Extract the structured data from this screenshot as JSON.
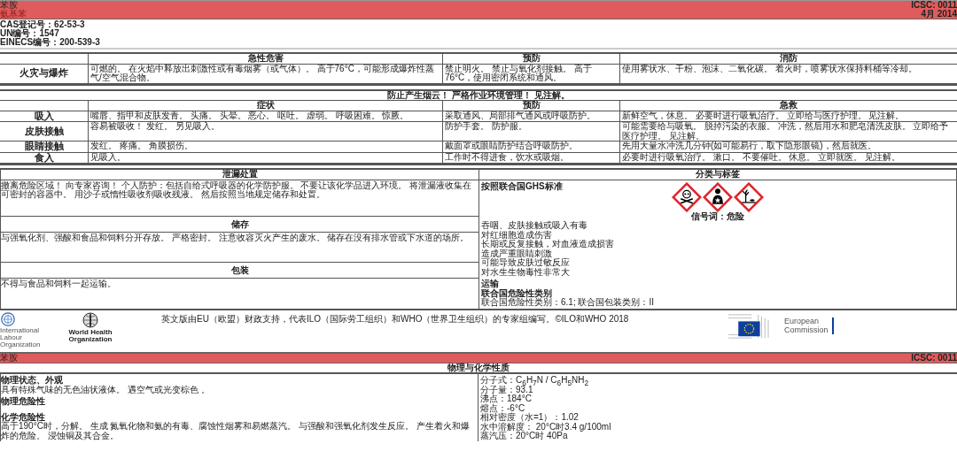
{
  "header": {
    "name": "苯胺",
    "synonym": "氨基苯",
    "icsc": "ICSC: 0011",
    "date": "4月 2014"
  },
  "identifiers": [
    "CAS登记号：62-53-3",
    "UN编号：1547",
    "EINECS编号：200-539-3"
  ],
  "fire_table": {
    "columns": [
      "急性危害",
      "预防",
      "消防"
    ],
    "rows": [
      {
        "label": "火灾与爆炸",
        "cells": [
          "可燃的。 在火焰中释放出刺激性或有毒烟雾（或气体）。 高于76°C，可能形成爆炸性蒸气/空气混合物。",
          "禁止明火。 禁止与氧化剂接触。 高于76°C，使用密闭系统和通风。",
          "使用雾状水、干粉、泡沫、二氧化碳。 着火时，喷雾状水保持料桶等冷却。"
        ]
      }
    ]
  },
  "banner": "防止产生烟云！ 严格作业环境管理！ 见注解。",
  "exposure_table": {
    "columns": [
      "症状",
      "预防",
      "急救"
    ],
    "rows": [
      {
        "label": "吸入",
        "cells": [
          "嘴唇、指甲和皮肤发青。 头痛。 头晕。 恶心。 呕吐。 虚弱。 呼吸困难。 惊厥。",
          "采取通风、局部排气通风或呼吸防护。",
          "新鲜空气，休息。 必要时进行吸氧治疗。 立即给与医疗护理。 见注解。"
        ]
      },
      {
        "label": "皮肤接触",
        "cells": [
          "容易被吸收！ 发红。 另见吸入。",
          "防护手套。 防护服。",
          "可能需要给与吸氧。 脱掉污染的衣服。 冲洗，然后用水和肥皂清洗皮肤。 立即给予医疗护理。 见注解。"
        ]
      },
      {
        "label": "眼睛接触",
        "cells": [
          "发红。 疼痛。 角膜损伤。",
          "戴面罩或眼睛防护结合呼吸防护。",
          "先用大量水冲洗几分钟(如可能易行，取下隐形眼镜)，然后就医。"
        ]
      },
      {
        "label": "食入",
        "cells": [
          "见吸入。",
          "工作时不得进食，饮水或吸烟。",
          "必要时进行吸氧治疗。 漱口。 不要催吐。 休息。 立即就医。 见注解。"
        ]
      }
    ]
  },
  "left_sections": [
    {
      "title": "泄漏处置",
      "text": "撤离危险区域！ 向专家咨询！ 个人防护：包括自给式呼吸器的化学防护服。 不要让该化学品进入环境。 将泄漏液收集在可密封的容器中。 用沙子或惰性吸收剂吸收残液。 然后按照当地规定储存和处置。"
    },
    {
      "title": "储存",
      "text": "与强氧化剂、强酸和食品和饲料分开存放。 严格密封。 注意收容灭火产生的废水。 储存在没有排水管或下水道的场所。"
    },
    {
      "title": "包装",
      "text": "不得与食品和饲料一起运输。"
    }
  ],
  "classification": {
    "title": "分类与标签",
    "standard": "按照联合国GHS标准",
    "pictograms": [
      {
        "kind": "skull"
      },
      {
        "kind": "health"
      },
      {
        "kind": "environment"
      }
    ],
    "signal_word": "信号词：危险",
    "hazard_statements": [
      "吞咽、皮肤接触或吸入有毒",
      "对红细胞造成伤害",
      "长期或反复接触，对血液造成损害",
      "造成严重眼睛刺激",
      "可能导致皮肤过敏反应",
      "对水生生物毒性非常大"
    ],
    "transport_heading": "运输",
    "un_class_heading": "联合国危险性类别",
    "un_class": "联合国危险性类别：6.1; 联合国包装类别：II"
  },
  "footer": {
    "ilo_text": [
      "International",
      "Labour",
      "Organization"
    ],
    "who_text": [
      "World Health",
      "Organization"
    ],
    "credit": "英文版由EU（欧盟）财政支持，代表ILO（国际劳工组织）和WHO（世界卫生组织）的专家组编写。©ILO和WHO 2018",
    "ec_text": [
      "European",
      "Commission"
    ]
  },
  "second_header": {
    "name": "苯胺",
    "icsc": "ICSC: 0011"
  },
  "physical": {
    "title": "物理与化学性质",
    "left": [
      {
        "heading": "物理状态、外观",
        "text": "具有特殊气味的无色油状液体。 遇空气或光变棕色 。"
      },
      {
        "heading": "物理危险性"
      },
      {
        "heading": "化学危险性",
        "text": "高于190°C时，分解。 生成 氮氧化物和氨的有毒、腐蚀性烟雾和易燃蒸汽。 与强酸和强氧化剂发生反应。 产生着火和爆炸的危险。 浸蚀铜及其合金。"
      }
    ],
    "right": [
      "分子式：C$_{6}$H$_{7}$N / C$_{6}$H$_{5}$NH$_{2}$",
      "分子量：93.1",
      "沸点：184°C",
      "熔点：-6°C",
      "相对密度（水=1）：1.02",
      "水中溶解度： 20°C时3.4 g/100ml",
      "蒸汽压：20°C时 40Pa"
    ]
  }
}
